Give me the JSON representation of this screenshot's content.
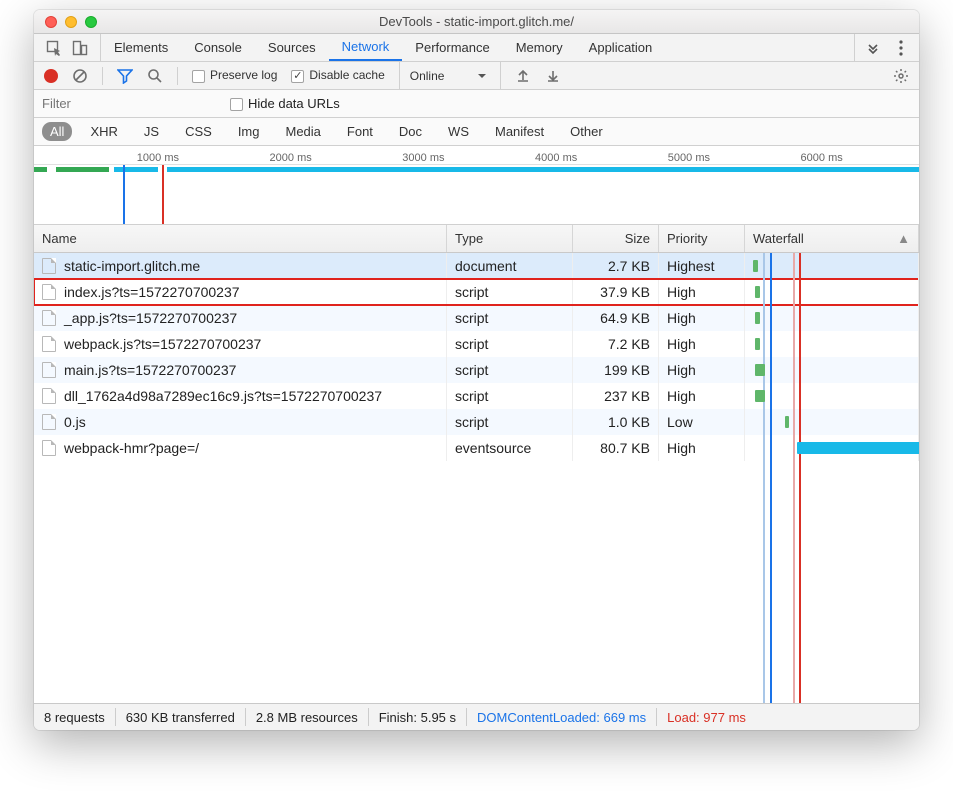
{
  "window": {
    "title": "DevTools - static-import.glitch.me/"
  },
  "panels": [
    "Elements",
    "Console",
    "Sources",
    "Network",
    "Performance",
    "Memory",
    "Application"
  ],
  "active_panel": "Network",
  "toolbar": {
    "preserve_log": "Preserve log",
    "disable_cache": "Disable cache",
    "throttle": "Online"
  },
  "filter": {
    "placeholder": "Filter",
    "hide_urls": "Hide data URLs"
  },
  "types": [
    "All",
    "XHR",
    "JS",
    "CSS",
    "Img",
    "Media",
    "Font",
    "Doc",
    "WS",
    "Manifest",
    "Other"
  ],
  "timeline_ticks": [
    "1000 ms",
    "2000 ms",
    "3000 ms",
    "4000 ms",
    "5000 ms",
    "6000 ms"
  ],
  "columns": {
    "name": "Name",
    "type": "Type",
    "size": "Size",
    "priority": "Priority",
    "waterfall": "Waterfall"
  },
  "rows": [
    {
      "name": "static-import.glitch.me",
      "type": "document",
      "size": "2.7 KB",
      "priority": "Highest"
    },
    {
      "name": "index.js?ts=1572270700237",
      "type": "script",
      "size": "37.9 KB",
      "priority": "High",
      "highlight": true
    },
    {
      "name": "_app.js?ts=1572270700237",
      "type": "script",
      "size": "64.9 KB",
      "priority": "High"
    },
    {
      "name": "webpack.js?ts=1572270700237",
      "type": "script",
      "size": "7.2 KB",
      "priority": "High"
    },
    {
      "name": "main.js?ts=1572270700237",
      "type": "script",
      "size": "199 KB",
      "priority": "High"
    },
    {
      "name": "dll_1762a4d98a7289ec16c9.js?ts=1572270700237",
      "type": "script",
      "size": "237 KB",
      "priority": "High"
    },
    {
      "name": "0.js",
      "type": "script",
      "size": "1.0 KB",
      "priority": "Low"
    },
    {
      "name": "webpack-hmr?page=/",
      "type": "eventsource",
      "size": "80.7 KB",
      "priority": "High"
    }
  ],
  "status": {
    "requests": "8 requests",
    "transferred": "630 KB transferred",
    "resources": "2.8 MB resources",
    "finish": "Finish: 5.95 s",
    "dcl": "DOMContentLoaded: 669 ms",
    "load": "Load: 977 ms"
  }
}
